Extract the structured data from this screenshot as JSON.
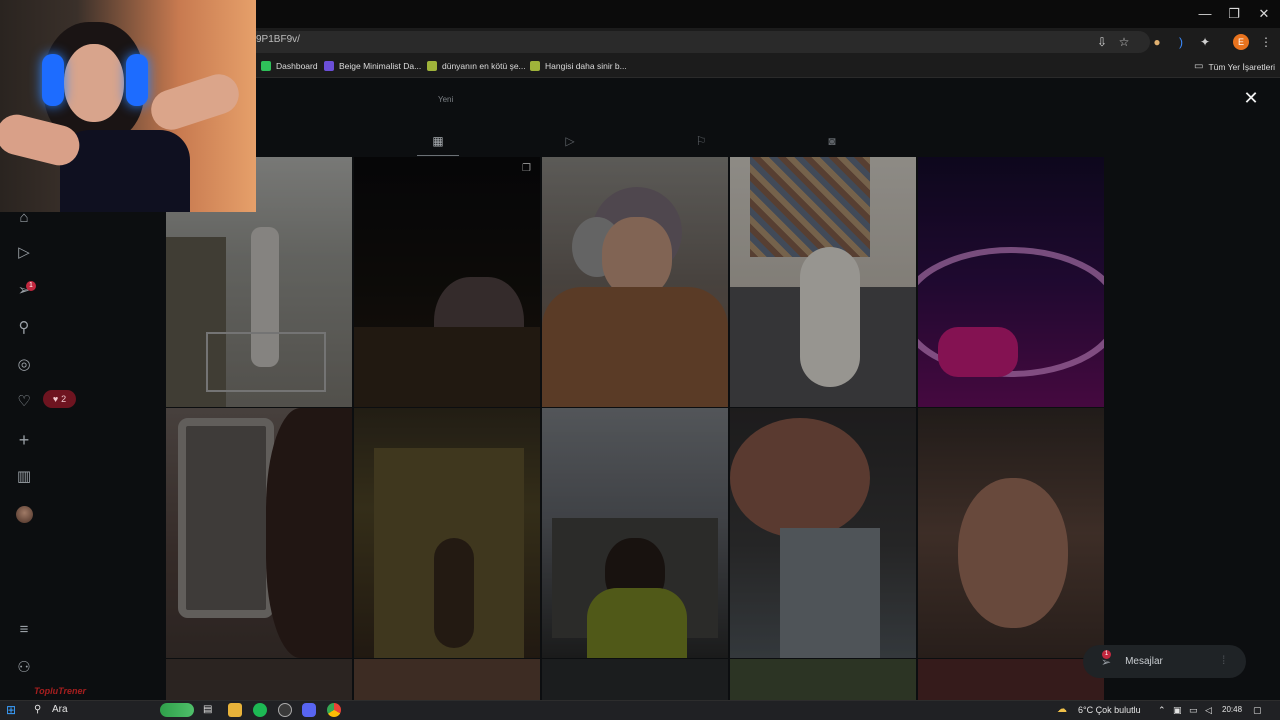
{
  "browser": {
    "url_partial": "9P1BF9v/",
    "window_controls": [
      "—",
      "❐",
      "✕"
    ],
    "bookmarks": [
      {
        "label": "Dashboard",
        "color": "#2fc15a"
      },
      {
        "label": "Beige Minimalist Da...",
        "color": "#6b4fd8"
      },
      {
        "label": "dünyanın en kötü şe...",
        "color": "#9fb33a"
      },
      {
        "label": "Hangisi daha sinir b...",
        "color": "#9fb33a"
      }
    ],
    "all_bookmarks_label": "Tüm Yer İşaretleri",
    "profile_initial": "E"
  },
  "sidebar": {
    "icons": [
      "home-icon",
      "reels-icon",
      "messages-icon",
      "search-icon",
      "explore-icon",
      "heart-icon",
      "create-icon",
      "insights-icon",
      "profile-avatar"
    ],
    "notification_count": "1",
    "likes_count": "2",
    "bottom_icons": [
      "menu-icon",
      "threads-icon"
    ]
  },
  "profile_view": {
    "new_label": "Yeni",
    "tabs": [
      "posts-tab",
      "reels-tab",
      "saved-tab",
      "tagged-tab"
    ],
    "active_tab": "posts-tab"
  },
  "grid": {
    "rows": [
      [
        "supermarket",
        "night-street",
        "earmuffs-portrait",
        "sofa-art-wall",
        "neon-sign"
      ],
      [
        "mirror-selfie",
        "old-building",
        "yellow-hoodie",
        "tilted-selfie",
        "closeup-selfie"
      ],
      [
        "partial-1",
        "partial-2",
        "partial-3",
        "partial-4",
        "partial-5"
      ]
    ]
  },
  "messages": {
    "label": "Mesajlar",
    "badge": "1"
  },
  "watermark": "TopluTrener",
  "taskbar": {
    "search_label": "Ara",
    "weather": "6°C  Çok bulutlu",
    "time": "20:48"
  }
}
